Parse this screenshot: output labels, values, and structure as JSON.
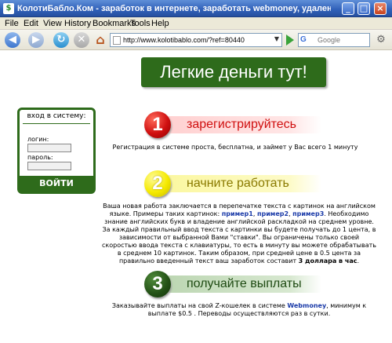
{
  "window": {
    "title": "КолотиБабло.Ком - заработок в интернете, заработать webmoney, удаленная работа, работа...",
    "minimize": "_",
    "maximize": "□",
    "close": "×"
  },
  "menu": {
    "items": [
      "File",
      "Edit",
      "View",
      "History",
      "Bookmarks",
      "Tools",
      "Help"
    ]
  },
  "toolbar": {
    "url": "http://www.kolotibablo.com/?ref=80440",
    "search_placeholder": "Google",
    "search_engine": "G"
  },
  "page": {
    "headline": "Легкие деньги тут!",
    "login": {
      "title": "вход в систему:",
      "login_label": "логин:",
      "password_label": "пароль:",
      "button": "ВОЙТИ"
    },
    "steps": [
      {
        "number": "1",
        "title": "зарегистрируйтесь",
        "text": "Регистрация в системе проста, бесплатна, и займет у Вас всего 1 минуту"
      },
      {
        "number": "2",
        "title": "начните работать",
        "text_parts": [
          "Ваша новая работа заключается в перепечатке текста с картинок на английском языке. Примеры таких картинок: ",
          "пример1",
          ", ",
          "пример2",
          ", ",
          "пример3",
          ". Необходимо знание английских букв и владение английской раскладкой на среднем уровне. За каждый правильный ввод текста с картинки вы будете получать до 1 цента, в зависимости от выбранной Вами \"ставки\". Вы ограничены только своей скоростью ввода текста с клавиатуры, то есть в минуту вы можете обрабатывать в среднем 10 картинок. Таким образом, при средней цене в 0.5 цента за правильно введенный текст ваш заработок составит ",
          "3 доллара в час",
          "."
        ]
      },
      {
        "number": "3",
        "title": "получайте выплаты",
        "text_parts": [
          "Заказывайте выплаты на свой Z-кошелек в системе ",
          "Webmoney",
          ", минимум к выплате $0.5 . Переводы осуществляются раз в сутки."
        ]
      }
    ]
  },
  "colors": {
    "brand_green": "#2e6b1b",
    "step1": "#d01010",
    "step2": "#f5ea00",
    "step3": "#224f15",
    "link": "#1a3aa8"
  },
  "icons": [
    "favicon-icon",
    "back-icon",
    "forward-icon",
    "reload-icon",
    "stop-icon",
    "home-icon",
    "page-icon",
    "go-icon",
    "google-icon",
    "gear-icon"
  ]
}
